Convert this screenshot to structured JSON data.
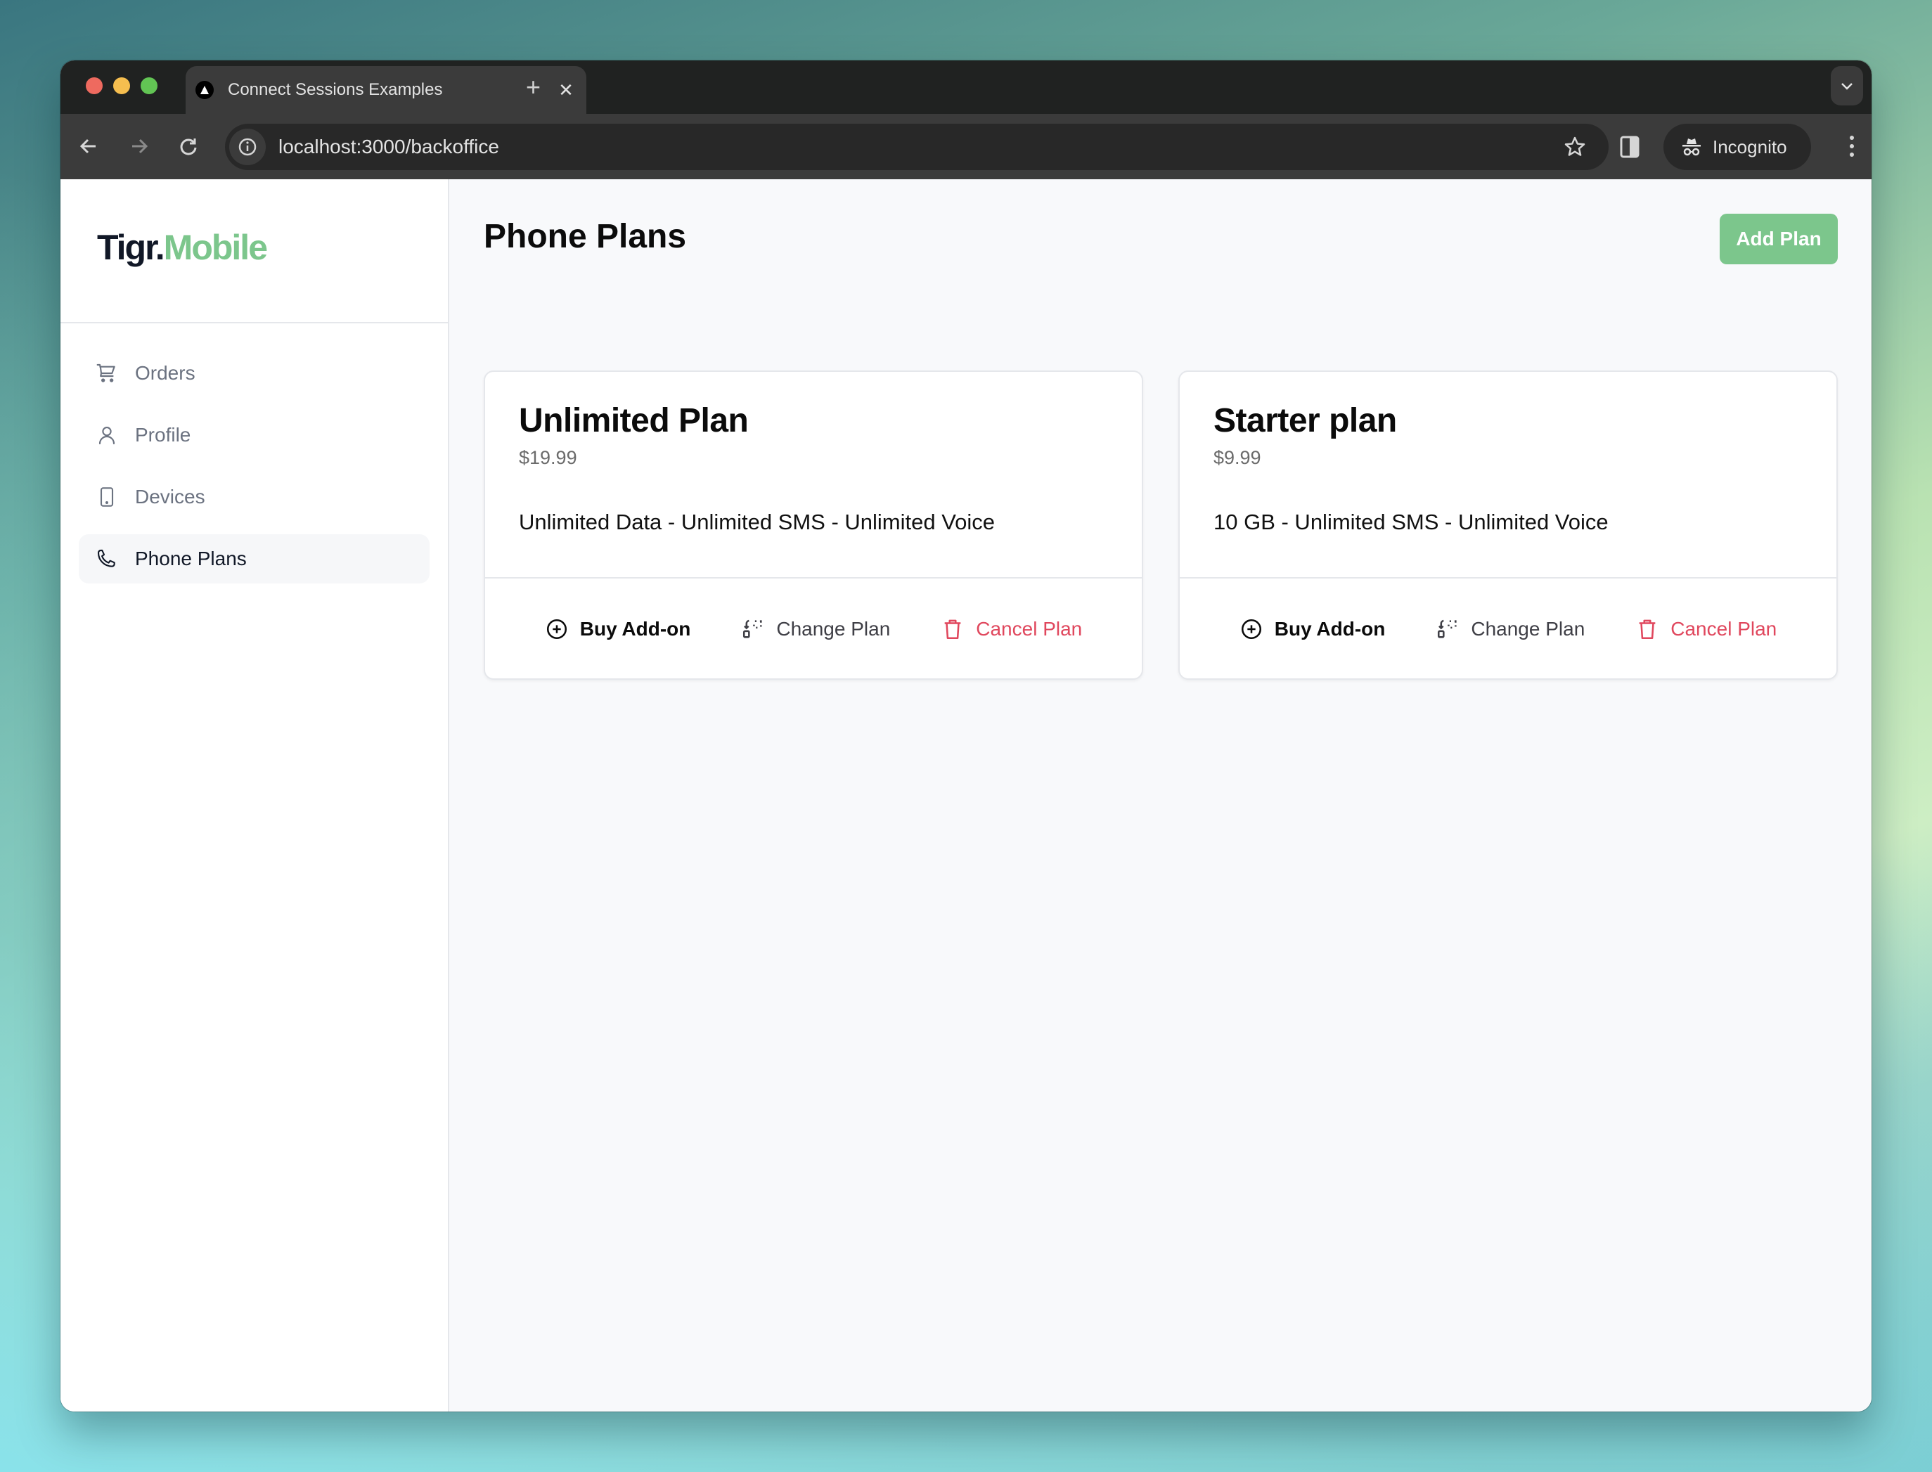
{
  "browser": {
    "tab_title": "Connect Sessions Examples",
    "url": "localhost:3000/backoffice",
    "incognito_label": "Incognito"
  },
  "app": {
    "logo_part1": "Tigr.",
    "logo_part2": "Mobile",
    "brand_color": "#7cc68c",
    "danger_color": "#e0475d"
  },
  "sidebar": {
    "items": [
      {
        "label": "Orders",
        "icon": "cart-icon",
        "active": false
      },
      {
        "label": "Profile",
        "icon": "user-icon",
        "active": false
      },
      {
        "label": "Devices",
        "icon": "device-icon",
        "active": false
      },
      {
        "label": "Phone Plans",
        "icon": "phone-icon",
        "active": true
      }
    ]
  },
  "main": {
    "title": "Phone Plans",
    "add_plan_label": "Add Plan",
    "plans": [
      {
        "name": "Unlimited Plan",
        "price": "$19.99",
        "description": "Unlimited Data - Unlimited SMS - Unlimited Voice",
        "actions": {
          "buy": "Buy Add-on",
          "change": "Change Plan",
          "cancel": "Cancel Plan"
        }
      },
      {
        "name": "Starter plan",
        "price": "$9.99",
        "description": "10 GB - Unlimited SMS - Unlimited Voice",
        "actions": {
          "buy": "Buy Add-on",
          "change": "Change Plan",
          "cancel": "Cancel Plan"
        }
      }
    ]
  }
}
